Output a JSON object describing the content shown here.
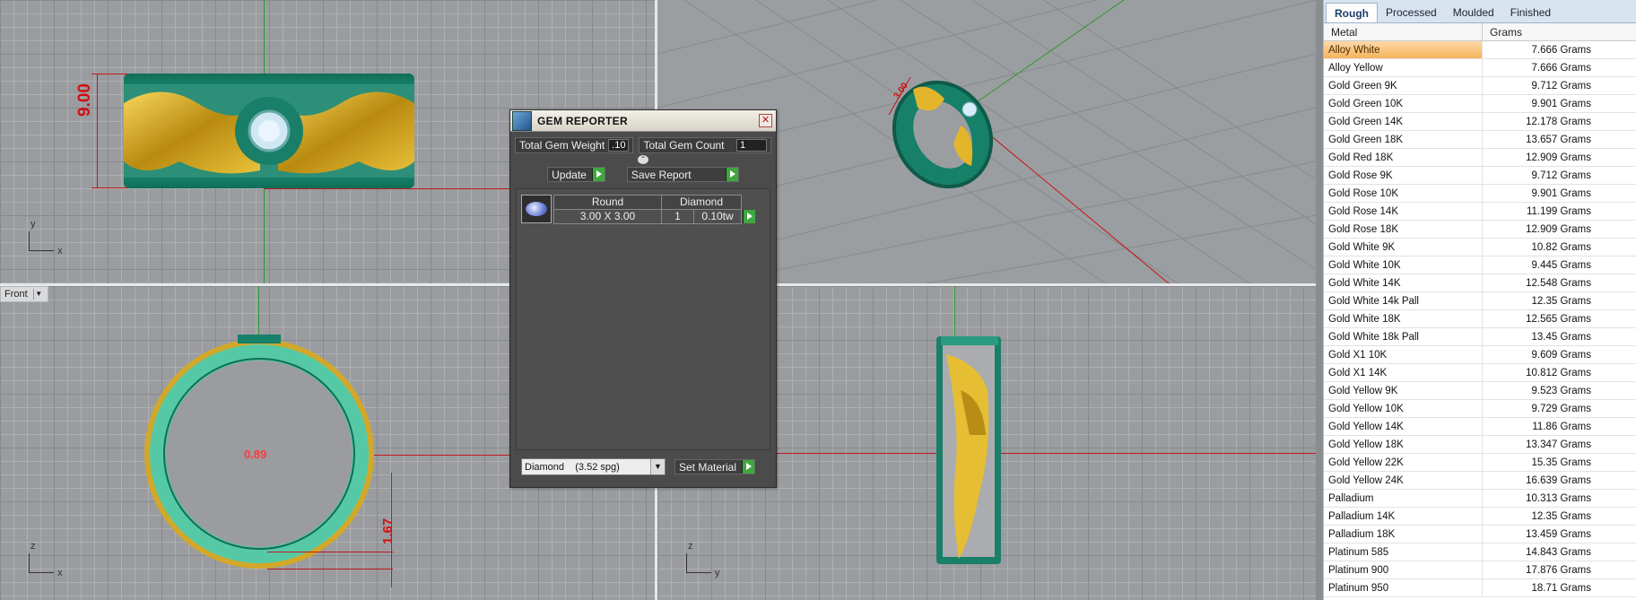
{
  "viewports": {
    "front_label": "Front",
    "top_dim": "9.00",
    "front_dim": "1.67",
    "front_center_text": "0.89",
    "persp_dim": "3.00",
    "top_axes": {
      "v": "y",
      "h": "x"
    },
    "front_axes": {
      "v": "z",
      "h": "x"
    },
    "right_axes": {
      "v": "z",
      "h": "y"
    }
  },
  "gem_reporter": {
    "title": "GEM REPORTER",
    "total_weight_label": "Total Gem Weight",
    "total_weight_value": ".10",
    "total_count_label": "Total Gem Count",
    "total_count_value": "1",
    "update_label": "Update",
    "save_report_label": "Save Report",
    "gem": {
      "shape_header": "Round",
      "type_header": "Diamond",
      "size": "3.00 X 3.00",
      "count": "1",
      "weight": "0.10tw"
    },
    "material_select": "Diamond    (3.52 spg)",
    "set_material_label": "Set Material"
  },
  "metal_panel": {
    "tabs": [
      "Rough",
      "Processed",
      "Moulded",
      "Finished"
    ],
    "active_tab": "Rough",
    "columns": [
      "Metal",
      "Grams"
    ],
    "rows": [
      {
        "metal": "Alloy White",
        "grams": "7.666 Grams"
      },
      {
        "metal": "Alloy Yellow",
        "grams": "7.666 Grams"
      },
      {
        "metal": "Gold Green 9K",
        "grams": "9.712 Grams"
      },
      {
        "metal": "Gold Green 10K",
        "grams": "9.901 Grams"
      },
      {
        "metal": "Gold Green 14K",
        "grams": "12.178 Grams"
      },
      {
        "metal": "Gold Green 18K",
        "grams": "13.657 Grams"
      },
      {
        "metal": "Gold Red 18K",
        "grams": "12.909 Grams"
      },
      {
        "metal": "Gold Rose 9K",
        "grams": "9.712 Grams"
      },
      {
        "metal": "Gold Rose 10K",
        "grams": "9.901 Grams"
      },
      {
        "metal": "Gold Rose 14K",
        "grams": "11.199 Grams"
      },
      {
        "metal": "Gold Rose 18K",
        "grams": "12.909 Grams"
      },
      {
        "metal": "Gold White 9K",
        "grams": "10.82 Grams"
      },
      {
        "metal": "Gold White 10K",
        "grams": "9.445 Grams"
      },
      {
        "metal": "Gold White 14K",
        "grams": "12.548 Grams"
      },
      {
        "metal": "Gold White 14k Pall",
        "grams": "12.35 Grams"
      },
      {
        "metal": "Gold White 18K",
        "grams": "12.565 Grams"
      },
      {
        "metal": "Gold White 18k Pall",
        "grams": "13.45 Grams"
      },
      {
        "metal": "Gold X1 10K",
        "grams": "9.609 Grams"
      },
      {
        "metal": "Gold X1 14K",
        "grams": "10.812 Grams"
      },
      {
        "metal": "Gold Yellow 9K",
        "grams": "9.523 Grams"
      },
      {
        "metal": "Gold Yellow 10K",
        "grams": "9.729 Grams"
      },
      {
        "metal": "Gold Yellow 14K",
        "grams": "11.86 Grams"
      },
      {
        "metal": "Gold Yellow 18K",
        "grams": "13.347 Grams"
      },
      {
        "metal": "Gold Yellow 22K",
        "grams": "15.35 Grams"
      },
      {
        "metal": "Gold Yellow 24K",
        "grams": "16.639 Grams"
      },
      {
        "metal": "Palladium",
        "grams": "10.313 Grams"
      },
      {
        "metal": "Palladium 14K",
        "grams": "12.35 Grams"
      },
      {
        "metal": "Palladium 18K",
        "grams": "13.459 Grams"
      },
      {
        "metal": "Platinum 585",
        "grams": "14.843 Grams"
      },
      {
        "metal": "Platinum 900",
        "grams": "17.876 Grams"
      },
      {
        "metal": "Platinum 950",
        "grams": "18.71 Grams"
      }
    ]
  }
}
